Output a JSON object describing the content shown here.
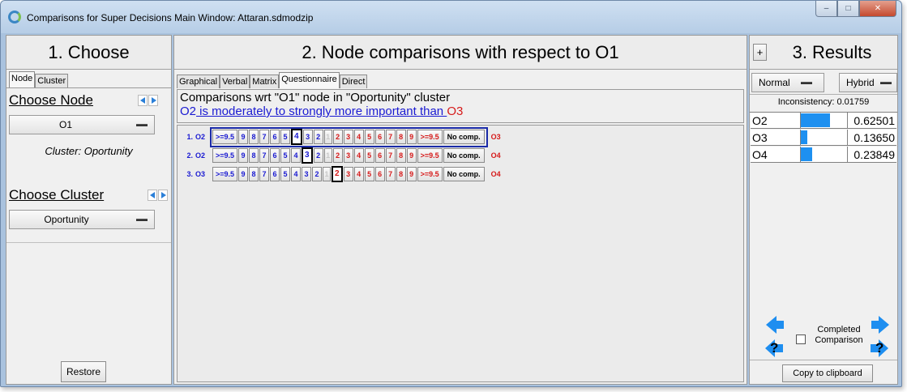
{
  "window": {
    "title": "Comparisons for Super Decisions Main Window: Attaran.sdmodzip",
    "minimize_glyph": "–",
    "maximize_glyph": "□",
    "close_glyph": "✕"
  },
  "left": {
    "header": "1. Choose",
    "tabs": [
      "Node",
      "Cluster"
    ],
    "choose_node_label": "Choose Node",
    "node_value": "O1",
    "cluster_text": "Cluster: Oportunity",
    "choose_cluster_label": "Choose Cluster",
    "cluster_value": "Oportunity",
    "restore_label": "Restore"
  },
  "middle": {
    "header": "2. Node comparisons with respect to O1",
    "tabs": [
      "Graphical",
      "Verbal",
      "Matrix",
      "Questionnaire",
      "Direct"
    ],
    "active_tab": "Questionnaire",
    "info_line1": "Comparisons wrt \"O1\" node in \"Oportunity\" cluster",
    "info_line2": {
      "left": "O2",
      "middle": " is moderately to strongly more important than ",
      "right": "O3"
    },
    "scale_left": [
      ">=9.5",
      "9",
      "8",
      "7",
      "6",
      "5",
      "4",
      "3",
      "2"
    ],
    "scale_right": [
      "2",
      "3",
      "4",
      "5",
      "6",
      "7",
      "8",
      "9",
      ">=9.5"
    ],
    "blank_cell": "1",
    "no_comp": "No comp.",
    "rows": [
      {
        "num": "1.",
        "left": "O2",
        "right": "O3",
        "selected_side": "left",
        "selected": "4"
      },
      {
        "num": "2.",
        "left": "O2",
        "right": "O4",
        "selected_side": "left",
        "selected": "3"
      },
      {
        "num": "3.",
        "left": "O3",
        "right": "O4",
        "selected_side": "right",
        "selected": "2"
      }
    ]
  },
  "right": {
    "expand_button": "+",
    "header": "3. Results",
    "mode_left": "Normal",
    "mode_right": "Hybrid",
    "inconsistency": "Inconsistency: 0.01759",
    "results": [
      {
        "name": "O2",
        "value": "0.62501",
        "fraction": 0.62501
      },
      {
        "name": "O3",
        "value": "0.13650",
        "fraction": 0.1365
      },
      {
        "name": "O4",
        "value": "0.23849",
        "fraction": 0.23849
      }
    ],
    "completed_label_1": "Completed",
    "completed_label_2": "Comparison",
    "copy_label": "Copy to clipboard",
    "help_glyph": "?"
  },
  "colors": {
    "left_node": "#1a1ad2",
    "right_node": "#d61a1a",
    "bar_fill": "#1e90f0",
    "selection_border": "#1a2aa8"
  }
}
